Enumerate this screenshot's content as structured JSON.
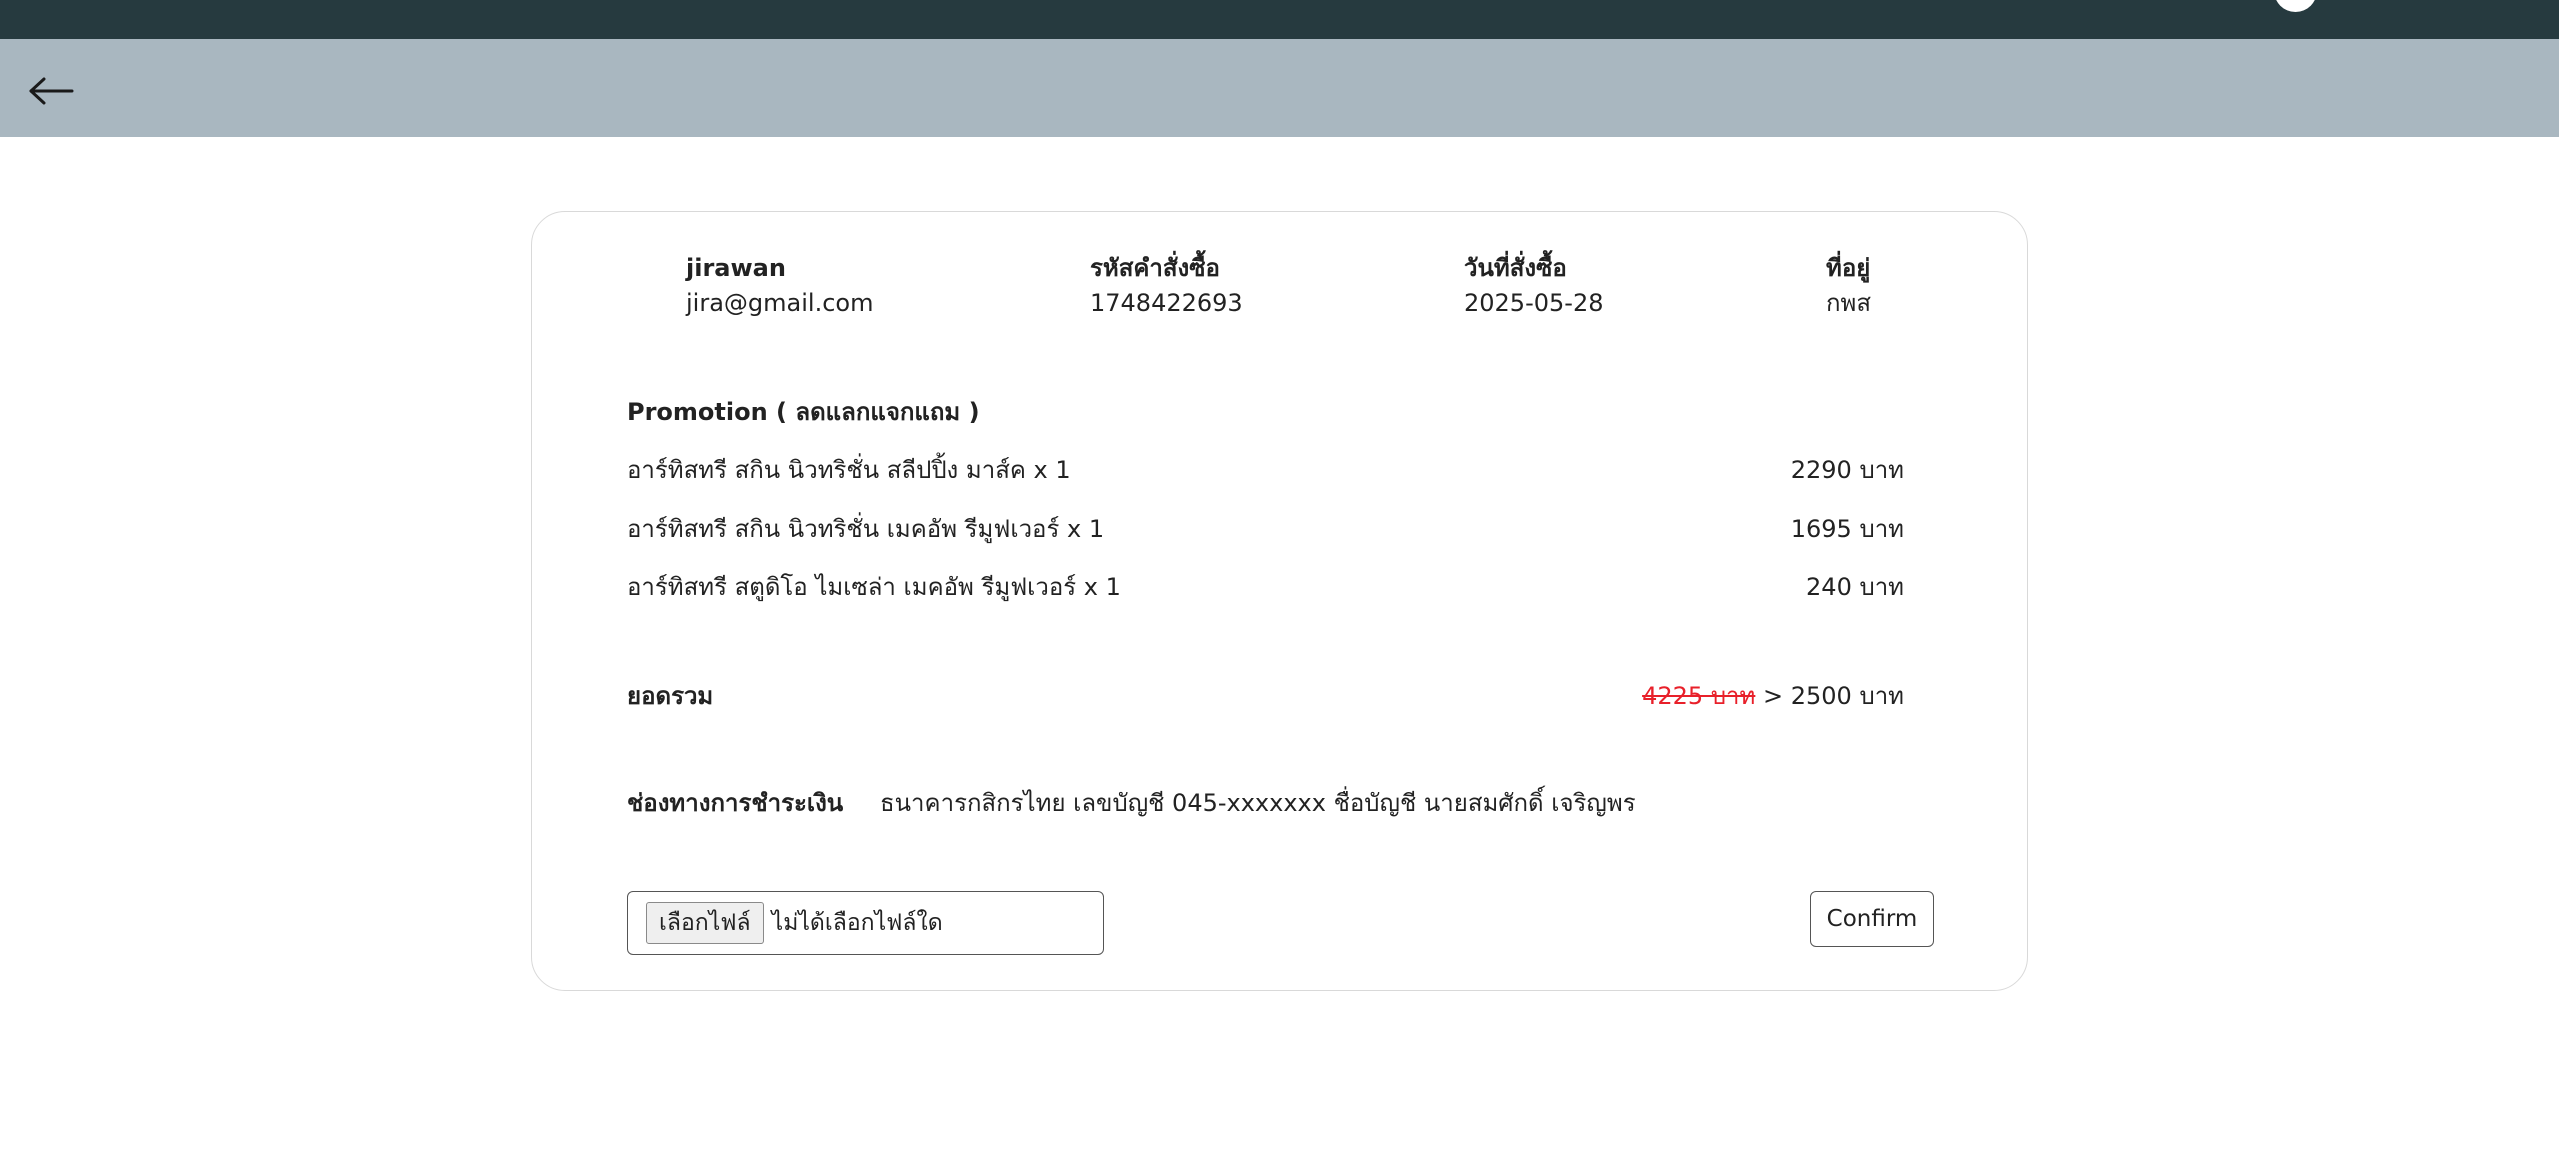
{
  "customer": {
    "name": "jirawan",
    "email": "jira@gmail.com"
  },
  "order_id": {
    "label": "รหัสคำสั่งซื้อ",
    "value": "1748422693"
  },
  "order_date": {
    "label": "วันที่สั่งซื้อ",
    "value": "2025-05-28"
  },
  "address": {
    "label": "ที่อยู่",
    "value": "กพส"
  },
  "promotion": {
    "heading": "Promotion ( ลดแลกแจกแถม )",
    "items": [
      {
        "name": "อาร์ทิสทรี สกิน นิวทริชั่น สลีปปิ้ง มาส์ค x 1",
        "price": "2290 บาท"
      },
      {
        "name": "อาร์ทิสทรี สกิน นิวทริชั่น เมคอัพ รีมูฟเวอร์ x 1",
        "price": "1695 บาท"
      },
      {
        "name": "อาร์ทิสทรี สตูดิโอ ไมเซล่า เมคอัพ รีมูฟเวอร์ x 1",
        "price": "240 บาท"
      }
    ]
  },
  "total": {
    "label": "ยอดรวม",
    "original": "4225 บาท",
    "separator": ">",
    "final": "2500 บาท"
  },
  "payment": {
    "label": "ช่องทางการชำระเงิน",
    "detail": "ธนาคารกสิกรไทย เลขบัญชี 045-xxxxxxx ชื่อบัญชี นายสมศักดิ์ เจริญพร"
  },
  "upload": {
    "button_label": "เลือกไฟล์",
    "status": "ไม่ได้เลือกไฟล์ใด"
  },
  "confirm_label": "Confirm",
  "colors": {
    "topbar": "#263a3f",
    "subbar": "#a9b7c0",
    "strike_price": "#e8202a"
  },
  "icons": {
    "back": "arrow-left-icon",
    "avatar": "user-avatar-icon"
  }
}
